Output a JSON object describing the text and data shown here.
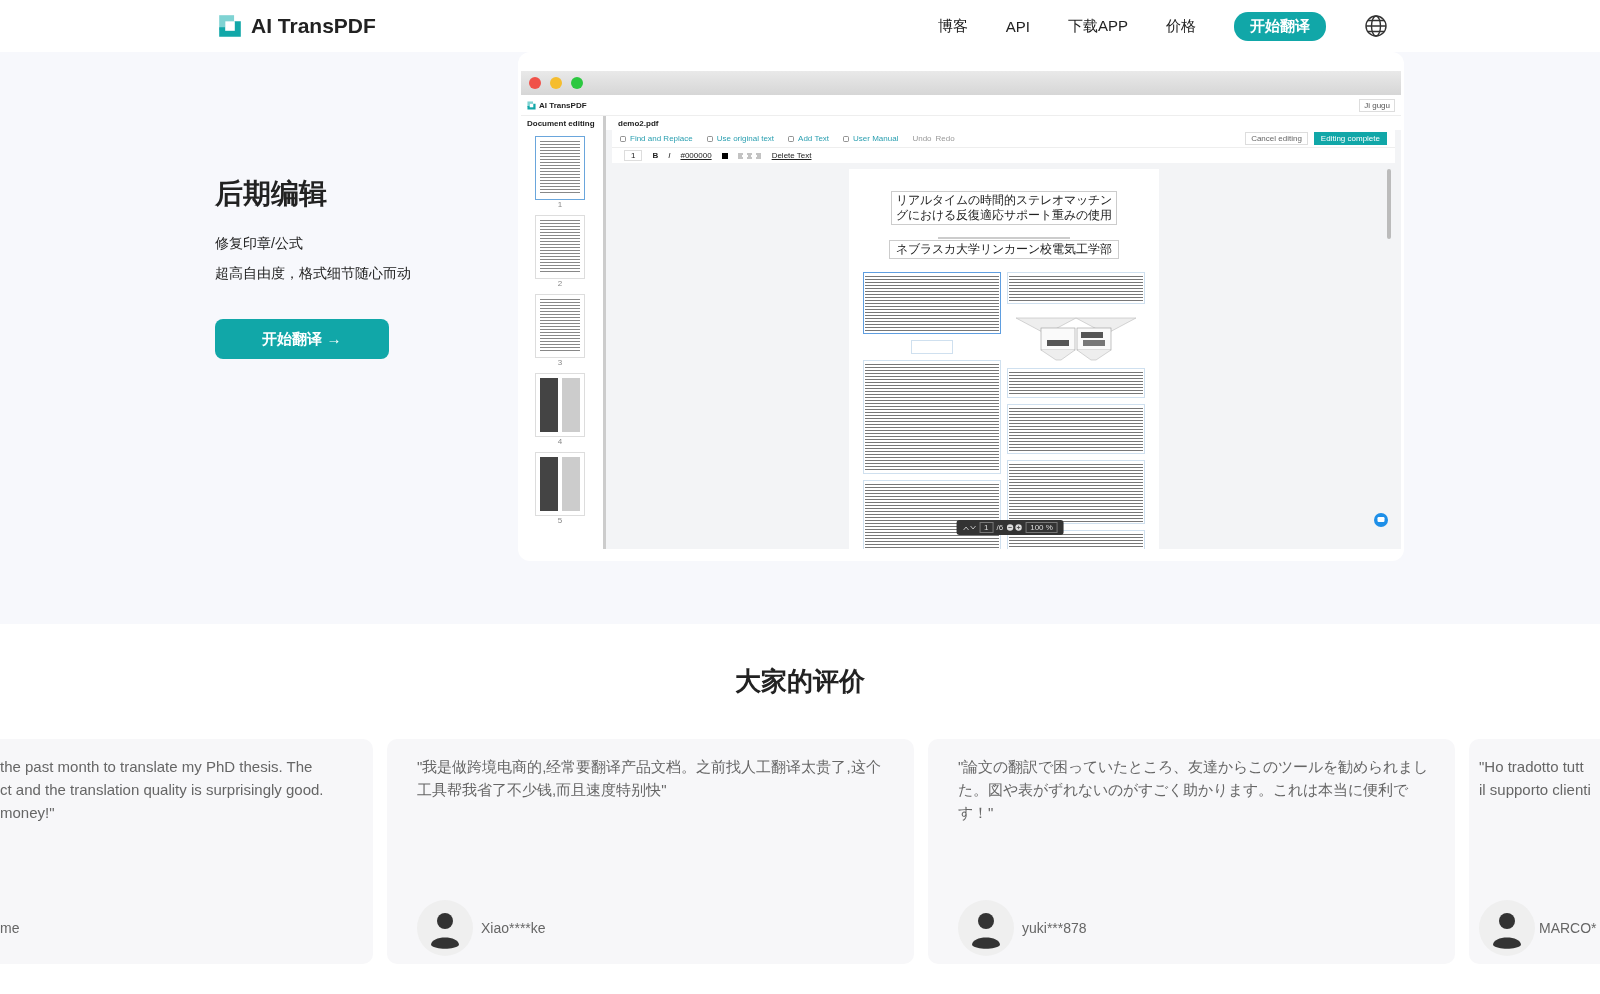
{
  "header": {
    "logo": "AI TransPDF",
    "nav": [
      {
        "label": "博客"
      },
      {
        "label": "API"
      },
      {
        "label": "下载APP"
      },
      {
        "label": "价格"
      }
    ],
    "cta": "开始翻译"
  },
  "feature": {
    "title": "后期编辑",
    "lines": [
      "修复印章/公式",
      "超高自由度，格式细节随心而动"
    ],
    "button": "开始翻译 →"
  },
  "app_screenshot": {
    "app_name": "AI TransPDF",
    "user_button": "Ji gugu",
    "sidebar_title": "Document editing",
    "file_name": "demo2.pdf",
    "thumbnails": [
      {
        "kind": "text",
        "page": "1",
        "selected": true
      },
      {
        "kind": "text",
        "page": "2",
        "selected": false
      },
      {
        "kind": "text",
        "page": "3",
        "selected": false
      },
      {
        "kind": "figures",
        "page": "4",
        "selected": false
      },
      {
        "kind": "figures",
        "page": "5",
        "selected": false
      }
    ],
    "toolbar": [
      {
        "label": "Find and Replace"
      },
      {
        "label": "Use original text"
      },
      {
        "label": "Add Text"
      },
      {
        "label": "User Manual"
      }
    ],
    "history": [
      "Undo",
      "Redo"
    ],
    "cancel_button": "Cancel editing",
    "complete_button": "Editing complete",
    "format_bar": {
      "font_size": "1",
      "styles": [
        "B",
        "I"
      ],
      "color": "#000000",
      "delete": "Delete Text"
    },
    "document": {
      "title_lines": [
        "リアルタイムの時間的ステレオマッチン",
        "グにおける反復適応サポート重みの使用"
      ],
      "affiliation": "ネブラスカ大学リンカーン校電気工学部"
    },
    "pager": {
      "page": "1",
      "total": "/6",
      "zoom": "100 %"
    }
  },
  "reviews": {
    "title": "大家的评价",
    "items": [
      {
        "text": "the past month to translate my PhD thesis. The\nct and the translation quality is surprisingly good.\nmoney!\"",
        "author": "me",
        "avatar": false
      },
      {
        "text": "\"我是做跨境电商的,经常要翻译产品文档。之前找人工翻译太贵了,这个工具帮我省了不少钱,而且速度特别快\"",
        "author": "Xiao****ke",
        "avatar": true
      },
      {
        "text": "\"論文の翻訳で困っていたところ、友達からこのツールを勧められました。図や表がずれないのがすごく助かります。これは本当に便利です！\"",
        "author": "yuki***878",
        "avatar": true
      },
      {
        "text": "\"Ho tradotto tutt\nil supporto clienti",
        "author": "MARCO*",
        "avatar": true
      }
    ]
  }
}
